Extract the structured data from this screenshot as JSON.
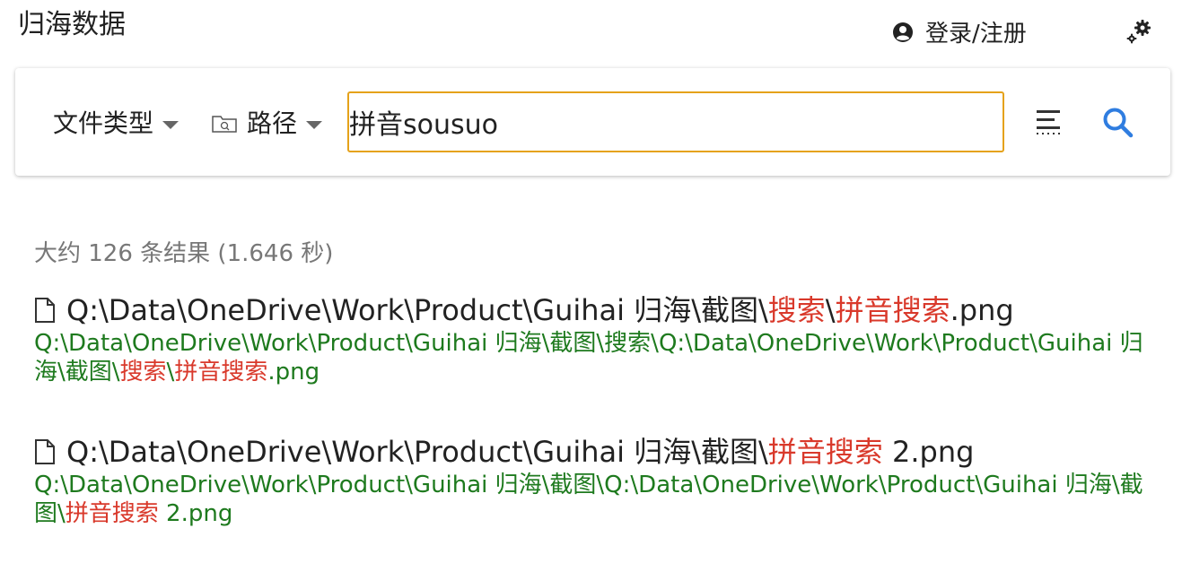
{
  "header": {
    "app_title": "归海数据",
    "login_label": "登录/注册"
  },
  "search": {
    "filter_type_label": "文件类型",
    "filter_path_label": "路径",
    "query": "拼音sousuo"
  },
  "results_summary": "大约 126 条结果 (1.646 秒)",
  "results": [
    {
      "title_prefix": "Q:\\Data\\OneDrive\\Work\\Product\\Guihai 归海\\截图\\",
      "title_hl1": "搜索",
      "title_mid": "\\",
      "title_hl2": "拼音搜索",
      "title_suffix": ".png",
      "path_prefix": "Q:\\Data\\OneDrive\\Work\\Product\\Guihai 归海\\截图\\搜索\\Q:\\Data\\OneDrive\\Work\\Product\\Guihai 归海\\截图\\",
      "path_hl1": "搜索",
      "path_mid": "\\",
      "path_hl2": "拼音搜索",
      "path_suffix": ".png"
    },
    {
      "title_prefix": "Q:\\Data\\OneDrive\\Work\\Product\\Guihai 归海\\截图\\",
      "title_hl": "拼音搜索",
      "title_suffix": " 2.png",
      "path_prefix": "Q:\\Data\\OneDrive\\Work\\Product\\Guihai 归海\\截图\\Q:\\Data\\OneDrive\\Work\\Product\\Guihai 归海\\截图\\",
      "path_hl": "拼音搜索",
      "path_suffix": " 2.png"
    }
  ],
  "colors": {
    "accent": "#e5a21a",
    "search_icon": "#2f7de0",
    "highlight": "#d9392b",
    "path": "#1e7a1e"
  },
  "icons": [
    "user-circle-icon",
    "gears-icon",
    "folder-icon",
    "sort-icon",
    "search-icon",
    "file-icon"
  ]
}
